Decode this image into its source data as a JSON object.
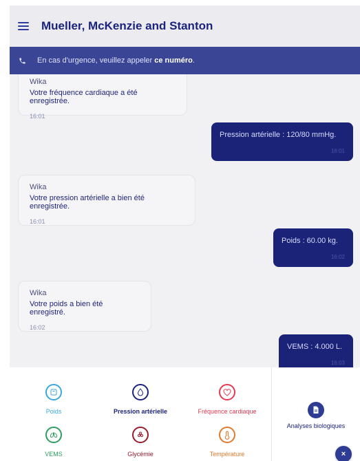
{
  "header": {
    "title": "Mueller, McKenzie and Stanton",
    "menu_icon": "hamburger-menu-icon"
  },
  "banner": {
    "text": "En cas d'urgence, veuillez appeler ",
    "link": "ce numéro",
    "suffix": ".",
    "icon": "phone-icon"
  },
  "chat": {
    "messages": [
      {
        "from": "Wika",
        "text": "Votre fréquence cardiaque a été enregistrée.",
        "time": "16:01"
      },
      {
        "from": "me",
        "text": "Pression artérielle : 120/80 mmHg.",
        "time": "16:01"
      },
      {
        "from": "Wika",
        "text": "Votre pression artérielle a bien été enregistrée.",
        "time": "16:01"
      },
      {
        "from": "me",
        "text": "Poids : 60.00 kg.",
        "time": "16:02"
      },
      {
        "from": "Wika",
        "text": "Votre poids a bien été enregistré.",
        "time": "16:02"
      },
      {
        "from": "me",
        "text": "VEMS : 4.000 L.",
        "time": "16:03"
      }
    ]
  },
  "measures": [
    {
      "label": "Poids",
      "color": "#3aa8e0",
      "icon": "scale-icon"
    },
    {
      "label": "Pression artérielle",
      "color": "#1a237e",
      "icon": "drop-icon"
    },
    {
      "label": "Fréquence cardiaque",
      "color": "#e53950",
      "icon": "heart-icon"
    },
    {
      "label": "VEMS",
      "color": "#2e9e5e",
      "icon": "lungs-icon"
    },
    {
      "label": "Glycémie",
      "color": "#9b1c2e",
      "icon": "glucose-icon"
    },
    {
      "label": "Température",
      "color": "#e07a2c",
      "icon": "thermometer-icon"
    }
  ],
  "analyses": {
    "label": "Analyses biologiques",
    "icon": "document-icon"
  },
  "close_button": {
    "glyph": "×"
  }
}
